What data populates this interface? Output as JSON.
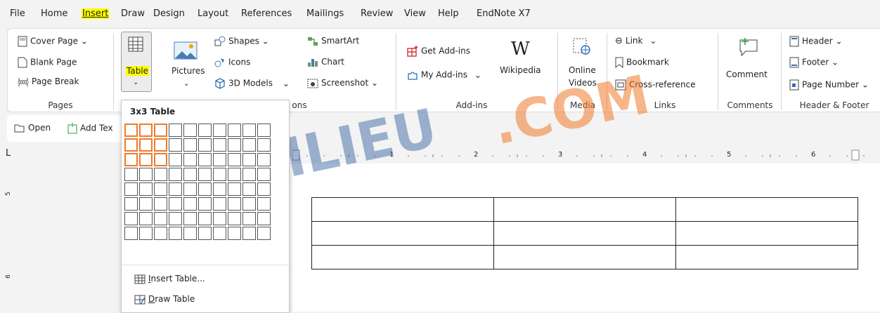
{
  "menubar": {
    "items": [
      "File",
      "Home",
      "Insert",
      "Draw",
      "Design",
      "Layout",
      "References",
      "Mailings",
      "Review",
      "View",
      "Help",
      "EndNote X7"
    ]
  },
  "ribbon": {
    "pages": {
      "cover_page": "Cover Page",
      "blank_page": "Blank Page",
      "page_break": "Page Break",
      "label": "Pages"
    },
    "tables": {
      "table": "Table"
    },
    "illustrations": {
      "pictures": "Pictures",
      "shapes": "Shapes",
      "icons": "Icons",
      "models_3d": "3D Models",
      "smartart": "SmartArt",
      "chart": "Chart",
      "screenshot": "Screenshot",
      "label_fragment": "ons"
    },
    "addins": {
      "get_addins": "Get Add-ins",
      "my_addins": "My Add-ins",
      "wikipedia": "Wikipedia",
      "label": "Add-ins"
    },
    "media": {
      "online_videos_1": "Online",
      "online_videos_2": "Videos",
      "label": "Media"
    },
    "links": {
      "link": "Link",
      "bookmark": "Bookmark",
      "cross_reference": "Cross-reference",
      "label": "Links"
    },
    "comments": {
      "comment": "Comment",
      "label": "Comments"
    },
    "header_footer": {
      "header": "Header",
      "footer": "Footer",
      "page_number": "Page Number",
      "label": "Header & Footer"
    }
  },
  "quickbar": {
    "open": "Open",
    "add_text": "Add Tex"
  },
  "ruler": {
    "marks": [
      "1",
      "2",
      "3",
      "4",
      "5",
      "6"
    ]
  },
  "vruler": {
    "marks": [
      "5",
      "6"
    ],
    "corner": "L"
  },
  "table_dropdown": {
    "title": "3x3 Table",
    "grid_cols": 10,
    "grid_rows": 8,
    "selected_cols": 3,
    "selected_rows": 3,
    "insert_table_ul": "I",
    "insert_table_rest": "nsert Table...",
    "draw_table_ul": "D",
    "draw_table_rest": "raw Table"
  },
  "document_table": {
    "rows": 3,
    "cols": 3
  },
  "watermark": {
    "part1": "TAILIEU",
    "part2": ".COM"
  },
  "colors": {
    "accent_highlight": "#ffff00",
    "grid_selected": "#f07a2a",
    "watermark_blue": "#2c5c9c",
    "watermark_orange": "#f07a2a"
  }
}
